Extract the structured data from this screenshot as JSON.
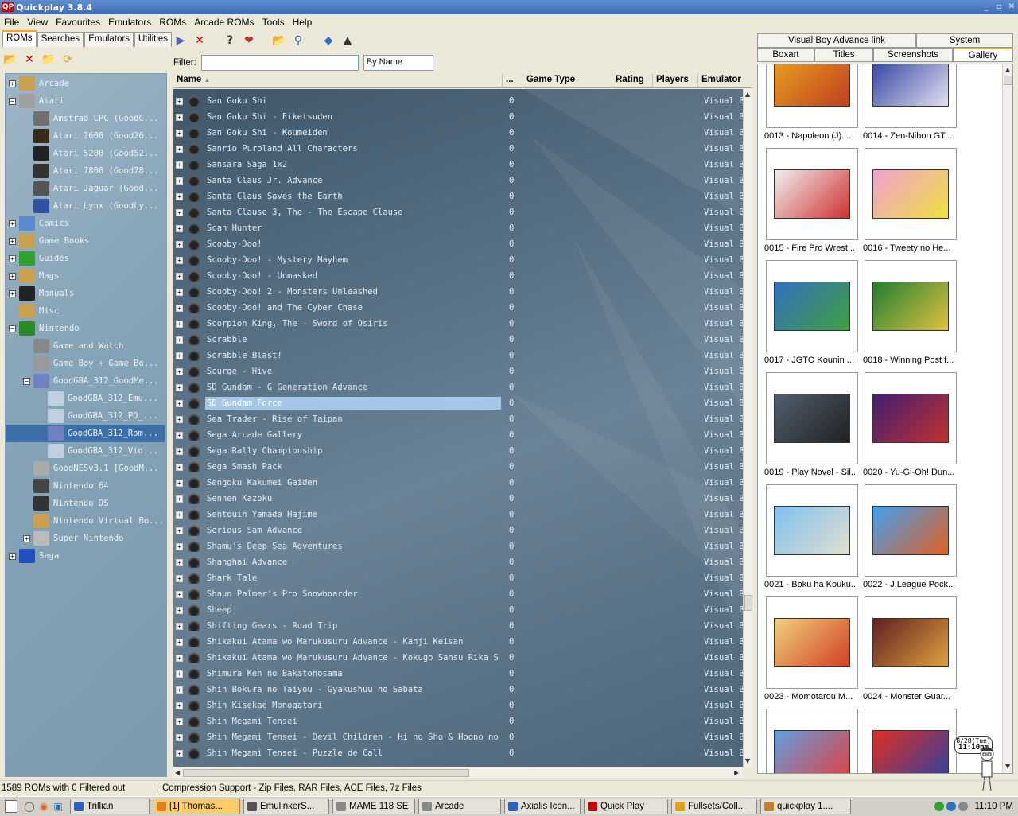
{
  "window": {
    "logo": "QP",
    "title": "Quickplay 3.8.4",
    "controls": [
      "_",
      "▫",
      "✕"
    ]
  },
  "menu": [
    "File",
    "View",
    "Favourites",
    "Emulators",
    "ROMs",
    "Arcade ROMs",
    "Tools",
    "Help"
  ],
  "left_tabs": [
    "ROMs",
    "Searches",
    "Emulators",
    "Utilities"
  ],
  "tree": [
    {
      "label": "Arcade",
      "exp": "+",
      "depth": 0,
      "color": "#c8a050"
    },
    {
      "label": "Atari",
      "exp": "−",
      "depth": 0,
      "color": "#a0a0a0"
    },
    {
      "label": "Amstrad CPC (GoodC...",
      "exp": "",
      "depth": 1,
      "color": "#707070"
    },
    {
      "label": "Atari 2600 (Good26...",
      "exp": "",
      "depth": 1,
      "color": "#3a2a1a"
    },
    {
      "label": "Atari 5200 (Good52...",
      "exp": "",
      "depth": 1,
      "color": "#222"
    },
    {
      "label": "Atari 7800 (Good78...",
      "exp": "",
      "depth": 1,
      "color": "#333"
    },
    {
      "label": "Atari Jaguar (Good...",
      "exp": "",
      "depth": 1,
      "color": "#555"
    },
    {
      "label": "Atari Lynx (GoodLy...",
      "exp": "",
      "depth": 1,
      "color": "#3050a0"
    },
    {
      "label": "Comics",
      "exp": "+",
      "depth": 0,
      "color": "#5a8ad0"
    },
    {
      "label": "Game Books",
      "exp": "+",
      "depth": 0,
      "color": "#c8a050"
    },
    {
      "label": "Guides",
      "exp": "+",
      "depth": 0,
      "color": "#30a030"
    },
    {
      "label": "Mags",
      "exp": "+",
      "depth": 0,
      "color": "#c8a050"
    },
    {
      "label": "Manuals",
      "exp": "+",
      "depth": 0,
      "color": "#222"
    },
    {
      "label": "Misc",
      "exp": "",
      "depth": 0,
      "color": "#c8a050"
    },
    {
      "label": "Nintendo",
      "exp": "−",
      "depth": 0,
      "color": "#2a8a2a"
    },
    {
      "label": "Game and Watch",
      "exp": "",
      "depth": 1,
      "color": "#888"
    },
    {
      "label": "Game Boy + Game Bo...",
      "exp": "",
      "depth": 1,
      "color": "#999"
    },
    {
      "label": "GoodGBA_312_GoodMe...",
      "exp": "−",
      "depth": 1,
      "color": "#7080c0"
    },
    {
      "label": "GoodGBA_312_Emu...",
      "exp": "",
      "depth": 2,
      "color": "#c0d0e0"
    },
    {
      "label": "GoodGBA_312_PD_...",
      "exp": "",
      "depth": 2,
      "color": "#c0d0e0"
    },
    {
      "label": "GoodGBA_312_Rom...",
      "exp": "",
      "depth": 2,
      "color": "#7080c0",
      "selected": true
    },
    {
      "label": "GoodGBA_312_Vid...",
      "exp": "",
      "depth": 2,
      "color": "#c0d0e0"
    },
    {
      "label": "GoodNESv3.1 [GoodM...",
      "exp": "",
      "depth": 1,
      "color": "#aaa"
    },
    {
      "label": "Nintendo 64",
      "exp": "",
      "depth": 1,
      "color": "#444"
    },
    {
      "label": "Nintendo DS",
      "exp": "",
      "depth": 1,
      "color": "#333"
    },
    {
      "label": "Nintendo Virtual Bo...",
      "exp": "",
      "depth": 1,
      "color": "#c8a050"
    },
    {
      "label": "Super Nintendo",
      "exp": "+",
      "depth": 1,
      "color": "#bbb"
    },
    {
      "label": "Sega",
      "exp": "+",
      "depth": 0,
      "color": "#2050c0"
    }
  ],
  "filter": {
    "label": "Filter:",
    "value": "",
    "sort": "By Name"
  },
  "columns": [
    "Name",
    "...",
    "Game Type",
    "Rating",
    "Players",
    "Emulator"
  ],
  "roms": [
    "San Goku Shi",
    "San Goku Shi - Eiketsuden",
    "San Goku Shi - Koumeiden",
    "Sanrio Puroland All Characters",
    "Sansara Saga 1x2",
    "Santa Claus Jr. Advance",
    "Santa Claus Saves the Earth",
    "Santa Clause 3, The - The Escape Clause",
    "Scan Hunter",
    "Scooby-Doo!",
    "Scooby-Doo! - Mystery Mayhem",
    "Scooby-Doo! - Unmasked",
    "Scooby-Doo! 2 - Monsters Unleashed",
    "Scooby-Doo! and The Cyber Chase",
    "Scorpion King, The - Sword of Osiris",
    "Scrabble",
    "Scrabble Blast!",
    "Scurge - Hive",
    "SD Gundam - G Generation Advance",
    "SD Gundam Force",
    "Sea Trader - Rise of Taipan",
    "Sega Arcade Gallery",
    "Sega Rally Championship",
    "Sega Smash Pack",
    "Sengoku Kakumei Gaiden",
    "Sennen Kazoku",
    "Sentouin Yamada Hajime",
    "Serious Sam Advance",
    "Shamu's Deep Sea Adventures",
    "Shanghai Advance",
    "Shark Tale",
    "Shaun Palmer's Pro Snowboarder",
    "Sheep",
    "Shifting Gears - Road Trip",
    "Shikakui Atama wo Marukusuru Advance - Kanji Keisan",
    "Shikakui Atama wo Marukusuru Advance - Kokugo Sansu Rika S...",
    "Shimura Ken no Bakatonosama",
    "Shin Bokura no Taiyou - Gyakushuu no Sabata",
    "Shin Kisekae Monogatari",
    "Shin Megami Tensei",
    "Shin Megami Tensei - Devil Children - Hi no Sho & Hoono no...",
    "Shin Megami Tensei - Puzzle de Call"
  ],
  "rom_selected_index": 19,
  "rom_count_value": "0",
  "rom_emulator": "Visual B",
  "right_tabs_top": [
    "Visual Boy Advance link",
    "System"
  ],
  "right_tabs_bottom": [
    "Boxart",
    "Titles",
    "Screenshots",
    "Gallery"
  ],
  "gallery": [
    {
      "caption": "0013 - Napoleon (J)....",
      "c1": "#e8a020",
      "c2": "#c04020"
    },
    {
      "caption": "0014 - Zen-Nihon GT ...",
      "c1": "#3040a0",
      "c2": "#e0e0f0"
    },
    {
      "caption": "0015 - Fire Pro Wrest...",
      "c1": "#f0f0f0",
      "c2": "#d03030"
    },
    {
      "caption": "0016 - Tweety no He...",
      "c1": "#f0a0d0",
      "c2": "#f0e040"
    },
    {
      "caption": "0017 - JGTO Kounin ...",
      "c1": "#3070c0",
      "c2": "#40a040"
    },
    {
      "caption": "0018 - Winning Post f...",
      "c1": "#208030",
      "c2": "#e0c040"
    },
    {
      "caption": "0019 - Play Novel - Sil...",
      "c1": "#506070",
      "c2": "#202020"
    },
    {
      "caption": "0020 - Yu-Gi-Oh! Dun...",
      "c1": "#402070",
      "c2": "#c03030"
    },
    {
      "caption": "0021 - Boku ha Kouku...",
      "c1": "#80c0f0",
      "c2": "#e0e0d0"
    },
    {
      "caption": "0022 - J.League Pock...",
      "c1": "#40a0f0",
      "c2": "#e06020"
    },
    {
      "caption": "0023 - Momotarou M...",
      "c1": "#f0d080",
      "c2": "#d04020"
    },
    {
      "caption": "0024 - Monster Guar...",
      "c1": "#602020",
      "c2": "#e0a040"
    },
    {
      "caption": "",
      "c1": "#60a0e0",
      "c2": "#e04040"
    },
    {
      "caption": "",
      "c1": "#e03020",
      "c2": "#3040a0"
    }
  ],
  "clock_widget": {
    "date": "8/28(Tue)",
    "time": "11:10pm"
  },
  "status": {
    "left": "1589 ROMs with 0 Filtered out",
    "right": "Compression Support - Zip Files, RAR Files, ACE Files, 7z Files"
  },
  "taskbar": [
    {
      "label": "Trillian",
      "color": "#3060c0"
    },
    {
      "label": "[1] Thomas...",
      "color": "#e08020",
      "active": true
    },
    {
      "label": "EmulinkerS...",
      "color": "#555"
    },
    {
      "label": "MAME 118 SE",
      "color": "#888"
    },
    {
      "label": "Arcade",
      "color": "#888"
    },
    {
      "label": "Axialis Icon...",
      "color": "#3060c0"
    },
    {
      "label": "Quick Play",
      "color": "#c00000"
    },
    {
      "label": "Fullsets/Coll...",
      "color": "#e0a020"
    },
    {
      "label": "quickplay 1....",
      "color": "#c08030"
    }
  ],
  "tray_time": "11:10 PM"
}
